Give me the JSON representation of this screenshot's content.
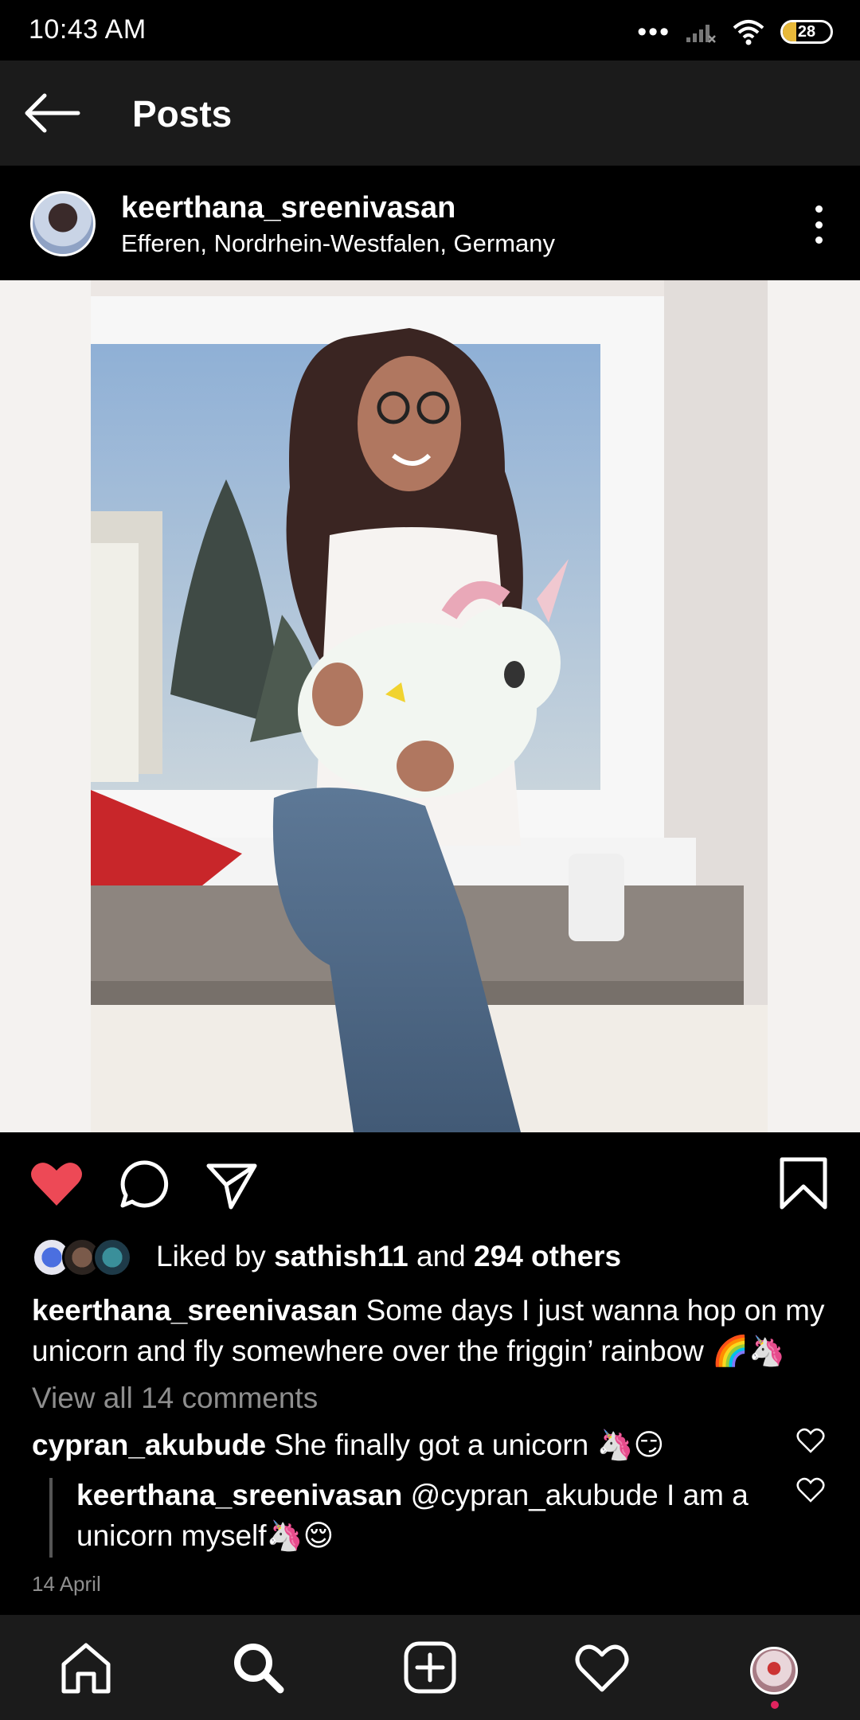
{
  "status_bar": {
    "time": "10:43 AM",
    "battery": "28",
    "icons": [
      "dots-icon",
      "signal-icon",
      "wifi-icon",
      "battery-icon"
    ]
  },
  "header": {
    "title": "Posts"
  },
  "post": {
    "username": "keerthana_sreenivasan",
    "location": "Efferen, Nordrhein-Westfalen, Germany",
    "likes": {
      "prefix": "Liked by ",
      "user": "sathish11",
      "middle": " and ",
      "others": "294 others"
    },
    "caption": {
      "user": "keerthana_sreenivasan",
      "text": " Some days I just wanna hop on my unicorn and fly somewhere over the friggin’ rainbow 🌈🦄"
    },
    "view_all": "View all 14 comments",
    "comments": [
      {
        "user": "cypran_akubude",
        "text": " She finally got a unicorn 🦄😏"
      },
      {
        "user": "keerthana_sreenivasan",
        "mention": " @cypran_akubude",
        "text": " I am a unicorn myself🦄😌"
      }
    ],
    "date": "14 April",
    "liked": true
  },
  "colors": {
    "like_red": "#ed4956",
    "muted": "#8e8e8e",
    "header_bg": "#1b1b1b"
  }
}
